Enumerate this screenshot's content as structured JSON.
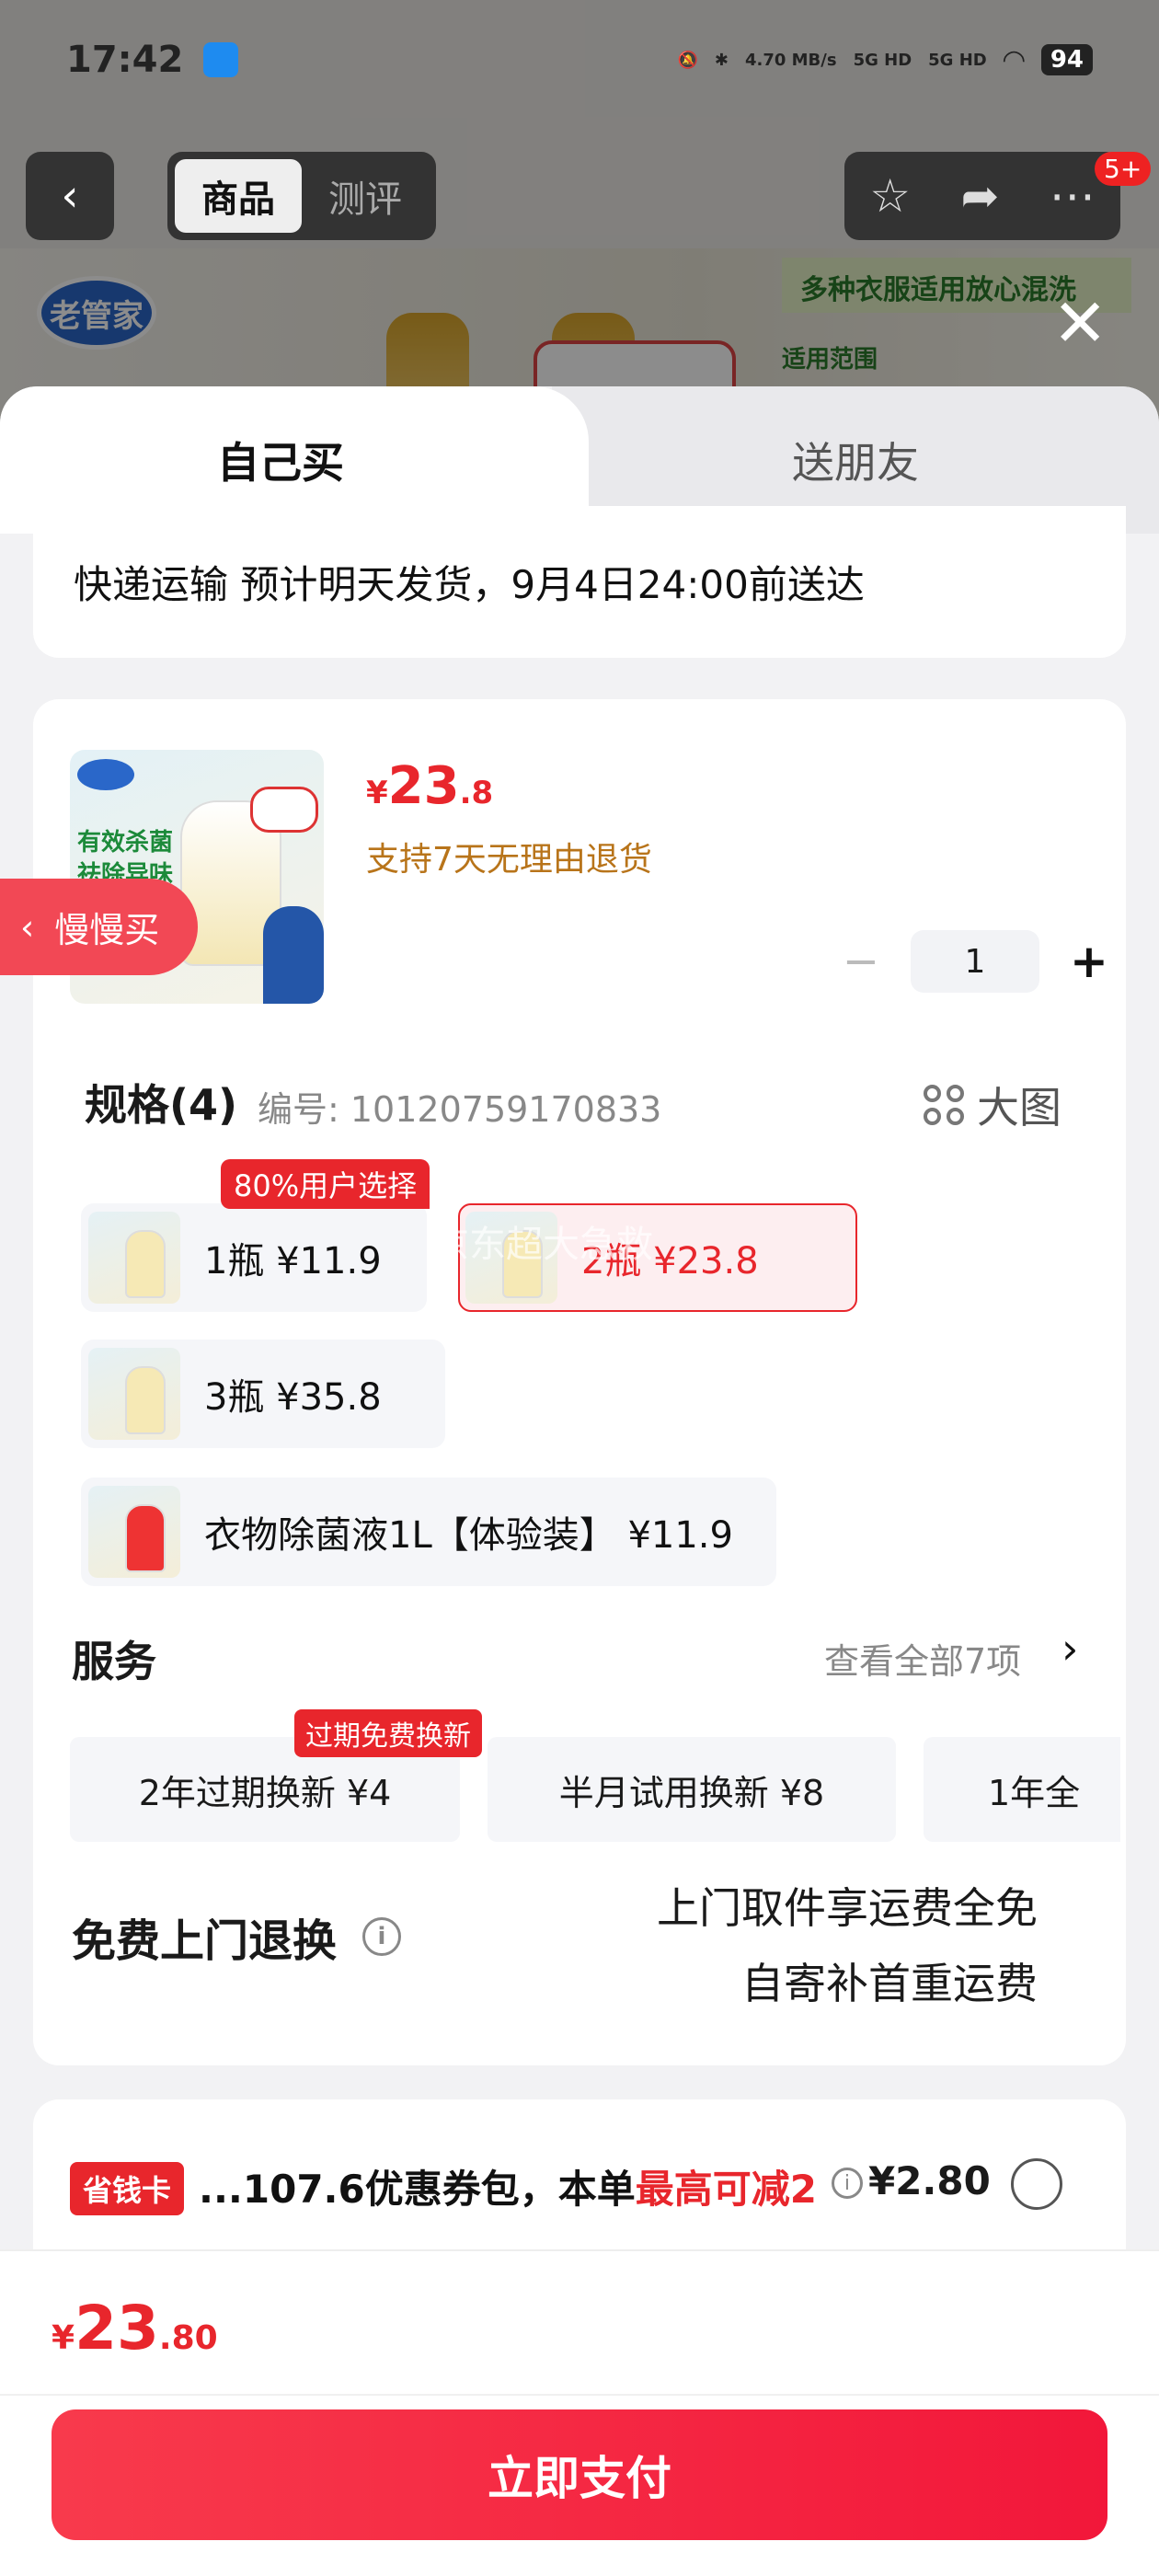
{
  "status_bar": {
    "time": "17:42",
    "net_speed": "4.70 MB/s",
    "signal1": "5G HD",
    "signal2": "5G HD",
    "battery": "94"
  },
  "nav": {
    "tab_product": "商品",
    "tab_review": "测评",
    "badge": "5+"
  },
  "background": {
    "brand": "老管家",
    "banner": "多种衣服适用放心混洗",
    "sub": "适用范围"
  },
  "sheet_tabs": {
    "self": "自己买",
    "gift": "送朋友"
  },
  "shipping": {
    "text": "快递运输 预计明天发货，9月4日24:00前送达"
  },
  "product": {
    "image_text1": "有效杀菌",
    "image_text2": "祛除异味",
    "price_symbol": "¥",
    "price_int": "23",
    "price_dec": ".8",
    "return_policy": "支持7天无理由退货",
    "quantity": "1",
    "minus": "−",
    "plus": "+"
  },
  "spec": {
    "title": "规格(4)",
    "sku": "编号: 10120759170833",
    "big_image": "大图",
    "popular_tag": "80%用户选择",
    "options": [
      {
        "label": "1瓶 ¥11.9"
      },
      {
        "label": "2瓶 ¥23.8"
      },
      {
        "label": "3瓶 ¥35.8"
      },
      {
        "label": "衣物除菌液1L【体验装】 ¥11.9"
      }
    ]
  },
  "service": {
    "title": "服务",
    "view_all": "查看全部7项",
    "arrow": "›",
    "tag": "过期免费换新",
    "items": [
      {
        "label": "2年过期换新 ¥4"
      },
      {
        "label": "半月试用换新 ¥8"
      },
      {
        "label": "1年全"
      }
    ],
    "return_title": "免费上门退换",
    "info": "i",
    "return_line1": "上门取件享运费全免",
    "return_line2": "自寄补首重运费"
  },
  "coupon": {
    "label": "省钱卡",
    "text": "...107.6优惠券包，本单",
    "highlight": "最高可减2",
    "info": "i",
    "amount": "¥2.80"
  },
  "bottom": {
    "price_symbol": "¥",
    "price_int": "23",
    "price_dec": ".80",
    "pay_button": "立即支付"
  },
  "slow_buy": "慢慢买",
  "watermark": "京东超大急救",
  "colors": {
    "accent": "#e8262c",
    "pay_button": "#f2173a",
    "return_note": "#b8741a"
  }
}
